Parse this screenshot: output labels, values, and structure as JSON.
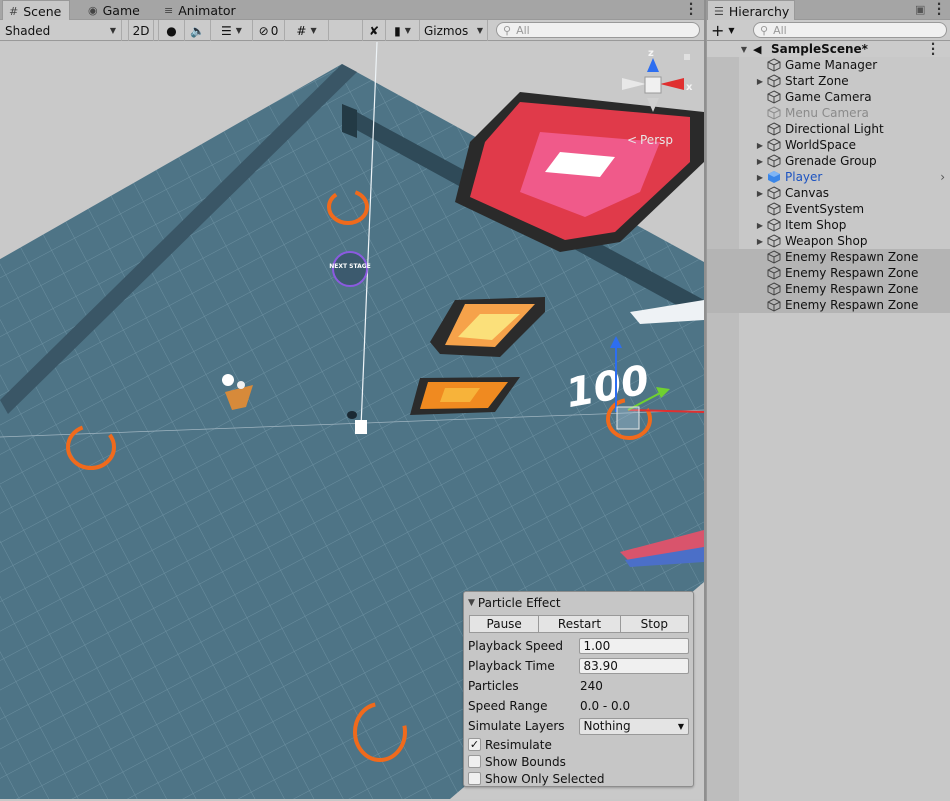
{
  "scene_tabs": [
    {
      "label": "Scene",
      "icon": "grid-icon"
    },
    {
      "label": "Game",
      "icon": "gamepad-icon"
    },
    {
      "label": "Animator",
      "icon": "animator-icon"
    }
  ],
  "toolbar": {
    "draw_mode": "Shaded",
    "mode_2d": "2D",
    "hidden_count": "0",
    "gizmos": "Gizmos",
    "search_placeholder": "All"
  },
  "scene_view": {
    "projection_label": "Persp",
    "axis_z": "z",
    "axis_x": "x",
    "sign_text": "NEXT STAGE",
    "floating_text": "100"
  },
  "particle_effect": {
    "title": "Particle Effect",
    "buttons": [
      "Pause",
      "Restart",
      "Stop"
    ],
    "fields": [
      {
        "label": "Playback Speed",
        "value": "1.00",
        "kind": "input"
      },
      {
        "label": "Playback Time",
        "value": "83.90",
        "kind": "input"
      },
      {
        "label": "Particles",
        "value": "240",
        "kind": "text"
      },
      {
        "label": "Speed Range",
        "value": "0.0 - 0.0",
        "kind": "text"
      },
      {
        "label": "Simulate Layers",
        "value": "Nothing",
        "kind": "select"
      }
    ],
    "checkboxes": [
      {
        "label": "Resimulate",
        "checked": true
      },
      {
        "label": "Show Bounds",
        "checked": false
      },
      {
        "label": "Show Only Selected",
        "checked": false
      }
    ]
  },
  "hierarchy": {
    "tab_label": "Hierarchy",
    "add_button": "+",
    "search_placeholder": "All",
    "scene_name": "SampleScene*",
    "items": [
      {
        "label": "Game Manager",
        "has_children": false,
        "state": "normal"
      },
      {
        "label": "Start Zone",
        "has_children": true,
        "state": "normal"
      },
      {
        "label": "Game Camera",
        "has_children": false,
        "state": "normal"
      },
      {
        "label": "Menu Camera",
        "has_children": false,
        "state": "disabled"
      },
      {
        "label": "Directional Light",
        "has_children": false,
        "state": "normal"
      },
      {
        "label": "WorldSpace",
        "has_children": true,
        "state": "normal"
      },
      {
        "label": "Grenade Group",
        "has_children": true,
        "state": "normal"
      },
      {
        "label": "Player",
        "has_children": true,
        "state": "prefab"
      },
      {
        "label": "Canvas",
        "has_children": true,
        "state": "normal"
      },
      {
        "label": "EventSystem",
        "has_children": false,
        "state": "normal"
      },
      {
        "label": "Item Shop",
        "has_children": true,
        "state": "normal"
      },
      {
        "label": "Weapon Shop",
        "has_children": true,
        "state": "normal"
      },
      {
        "label": "Enemy Respawn Zone",
        "has_children": false,
        "state": "selected"
      },
      {
        "label": "Enemy Respawn Zone",
        "has_children": false,
        "state": "selected"
      },
      {
        "label": "Enemy Respawn Zone",
        "has_children": false,
        "state": "selected"
      },
      {
        "label": "Enemy Respawn Zone",
        "has_children": false,
        "state": "selected"
      }
    ]
  }
}
